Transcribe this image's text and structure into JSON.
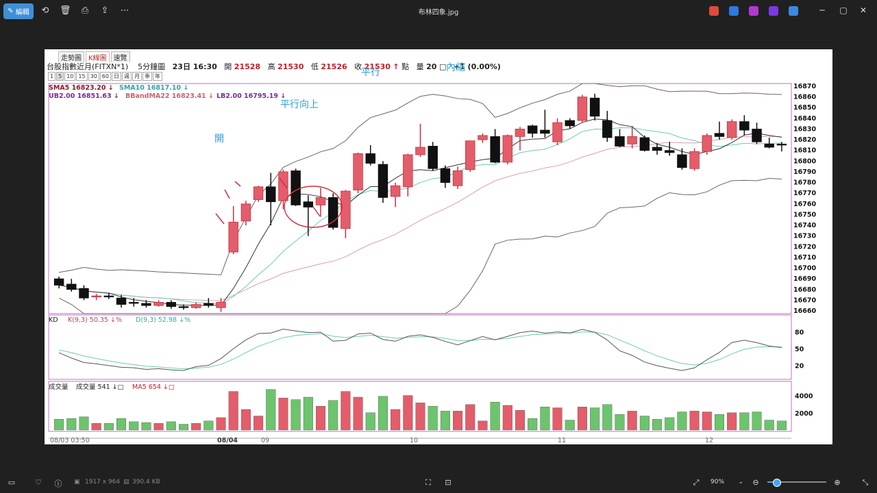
{
  "topbar": {
    "edit_label": "編輯",
    "file_title": "布林四象.jpg",
    "icons": [
      "rotate-icon",
      "delete-icon",
      "print-icon",
      "share-icon",
      "more-icon"
    ],
    "app_colors": [
      "#e04a3a",
      "#2b7be0",
      "#b03ad0",
      "#7a3ae0",
      "#3a8ae0"
    ]
  },
  "chart_window": {
    "tabs": [
      "走勢圖",
      "K線圖",
      "速覽"
    ],
    "active_tab": 1,
    "symbol": "台股指數近月(FITXN*1)",
    "interval": "5分鐘圖",
    "datetime": "23日 16:30",
    "open_label": "開",
    "open": "21528",
    "high_label": "高",
    "high": "21530",
    "low_label": "低",
    "low": "21526",
    "close_label": "收",
    "close": "21530",
    "arrow_up": "↑",
    "points_label": "點",
    "vol_label": "量",
    "vol": "20",
    "change": "+1 (0.00%)",
    "periods": [
      "1",
      "5",
      "10",
      "15",
      "30",
      "60",
      "日",
      "週",
      "月",
      "季",
      "年"
    ],
    "selected_period": 1
  },
  "chart_data": [
    {
      "type": "candlestick",
      "panel": "price",
      "legend": [
        {
          "text": "SMA5 16823.20",
          "color": "#8b1a2a"
        },
        {
          "text": "SMA10 16817.10",
          "color": "#2aa8a0"
        },
        {
          "text": "UB2.00 16851.63",
          "color": "#7a2a9a"
        },
        {
          "text": "BBandMA22 16823.41",
          "color": "#d06070"
        },
        {
          "text": "LB2.00 16795.19",
          "color": "#7a2a9a"
        }
      ],
      "ylim": [
        16660,
        16870
      ],
      "yticks": [
        16870,
        16860,
        16850,
        16840,
        16830,
        16820,
        16810,
        16800,
        16790,
        16780,
        16770,
        16760,
        16750,
        16740,
        16730,
        16720,
        16710,
        16700,
        16690,
        16680,
        16670,
        16660
      ],
      "ohlc": [
        [
          16690,
          16692,
          16681,
          16684
        ],
        [
          16685,
          16690,
          16678,
          16680
        ],
        [
          16681,
          16684,
          16670,
          16672
        ],
        [
          16673,
          16676,
          16670,
          16674
        ],
        [
          16674,
          16677,
          16671,
          16673
        ],
        [
          16672,
          16675,
          16663,
          16666
        ],
        [
          16668,
          16672,
          16664,
          16667
        ],
        [
          16667,
          16670,
          16663,
          16665
        ],
        [
          16665,
          16670,
          16664,
          16668
        ],
        [
          16668,
          16670,
          16662,
          16664
        ],
        [
          16664,
          16666,
          16661,
          16663
        ],
        [
          16663,
          16668,
          16662,
          16666
        ],
        [
          16667,
          16672,
          16663,
          16665
        ],
        [
          16663,
          16672,
          16659,
          16668
        ],
        [
          16715,
          16758,
          16713,
          16743
        ],
        [
          16744,
          16763,
          16740,
          16760
        ],
        [
          16764,
          16777,
          16762,
          16776
        ],
        [
          16776,
          16789,
          16740,
          16762
        ],
        [
          16763,
          16792,
          16755,
          16790
        ],
        [
          16791,
          16793,
          16758,
          16759
        ],
        [
          16762,
          16768,
          16730,
          16757
        ],
        [
          16759,
          16775,
          16748,
          16766
        ],
        [
          16766,
          16770,
          16736,
          16738
        ],
        [
          16737,
          16773,
          16728,
          16772
        ],
        [
          16773,
          16808,
          16770,
          16807
        ],
        [
          16807,
          16815,
          16796,
          16798
        ],
        [
          16797,
          16800,
          16761,
          16766
        ],
        [
          16767,
          16780,
          16757,
          16777
        ],
        [
          16776,
          16807,
          16767,
          16806
        ],
        [
          16806,
          16835,
          16804,
          16813
        ],
        [
          16814,
          16818,
          16791,
          16793
        ],
        [
          16793,
          16796,
          16775,
          16780
        ],
        [
          16777,
          16795,
          16774,
          16791
        ],
        [
          16792,
          16819,
          16790,
          16819
        ],
        [
          16820,
          16826,
          16817,
          16824
        ],
        [
          16823,
          16830,
          16798,
          16799
        ],
        [
          16799,
          16825,
          16797,
          16824
        ],
        [
          16823,
          16832,
          16810,
          16830
        ],
        [
          16833,
          16834,
          16822,
          16826
        ],
        [
          16829,
          16848,
          16822,
          16826
        ],
        [
          16818,
          16840,
          16815,
          16836
        ],
        [
          16838,
          16840,
          16830,
          16833
        ],
        [
          16838,
          16862,
          16836,
          16860
        ],
        [
          16859,
          16863,
          16838,
          16842
        ],
        [
          16838,
          16847,
          16818,
          16822
        ],
        [
          16823,
          16830,
          16813,
          16814
        ],
        [
          16816,
          16833,
          16812,
          16823
        ],
        [
          16822,
          16824,
          16809,
          16810
        ],
        [
          16813,
          16817,
          16806,
          16810
        ],
        [
          16810,
          16818,
          16805,
          16808
        ],
        [
          16806,
          16812,
          16792,
          16794
        ],
        [
          16793,
          16812,
          16791,
          16809
        ],
        [
          16809,
          16826,
          16806,
          16824
        ],
        [
          16826,
          16837,
          16820,
          16823
        ],
        [
          16822,
          16839,
          16820,
          16837
        ],
        [
          16837,
          16843,
          16824,
          16829
        ],
        [
          16830,
          16836,
          16816,
          16818
        ],
        [
          16816,
          16822,
          16812,
          16813
        ],
        [
          16816,
          16818,
          16809,
          16815
        ]
      ],
      "up_color": "#e35d6a",
      "down_color": "#111111",
      "date_labels": [
        "08/03 03:50",
        "08/04",
        "09",
        "10",
        "11",
        "12"
      ],
      "annotations": [
        "開",
        "平行向上",
        "平行",
        "內縮"
      ]
    },
    {
      "type": "line",
      "panel": "kd",
      "legend": [
        {
          "text": "KD",
          "color": "#222222"
        },
        {
          "text": "K(9,3) 50.35",
          "color": "#c04060"
        },
        {
          "text": "D(9,3) 52.98",
          "color": "#30b0a0"
        }
      ],
      "ylim": [
        0,
        100
      ],
      "yticks": [
        80,
        50,
        20
      ]
    },
    {
      "type": "bar",
      "panel": "volume",
      "legend": [
        {
          "text": "成交量",
          "color": "#222222"
        },
        {
          "text": "成交量 541",
          "color": "#222222"
        },
        {
          "text": "MA5 654",
          "color": "#c0202a"
        }
      ],
      "ylim": [
        0,
        5000
      ],
      "yticks": [
        4000,
        2000
      ],
      "up_color": "#e35d6a",
      "down_color": "#6cc46c"
    }
  ],
  "bottombar": {
    "dimensions": "1917 x 964",
    "filesize": "390.4 KB",
    "zoom": "90%",
    "zoom_level": 0.15
  }
}
